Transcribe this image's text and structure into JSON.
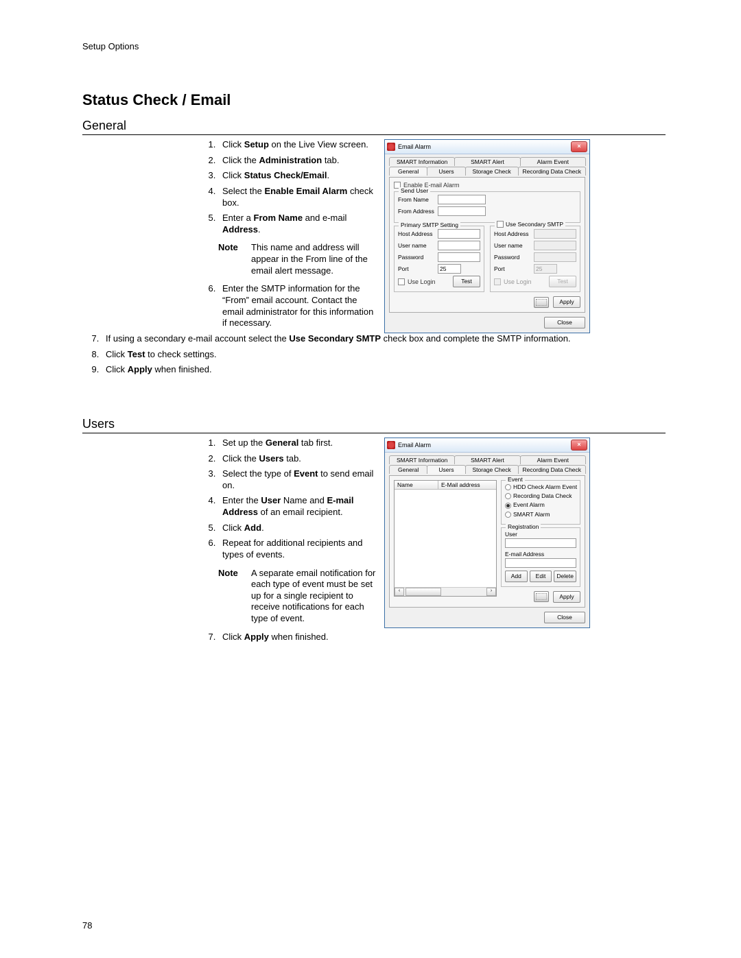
{
  "page": {
    "header": "Setup Options",
    "title": "Status Check / Email",
    "pageNumber": "78"
  },
  "general": {
    "heading": "General",
    "steps": {
      "s1a": "Click ",
      "s1b": "Setup",
      "s1c": " on the Live View screen.",
      "s2a": "Click the ",
      "s2b": "Administration",
      "s2c": " tab.",
      "s3a": "Click ",
      "s3b": "Status Check/Email",
      "s3c": ".",
      "s4a": "Select the ",
      "s4b": "Enable Email Alarm",
      "s4c": " check box.",
      "s5a": "Enter a ",
      "s5b": "From Name",
      "s5c": " and e-mail ",
      "s5d": "Address",
      "s5e": ".",
      "s6": "Enter the SMTP information for the “From” email account. Contact the email administrator for this information if necessary.",
      "s7a": "If using a secondary e-mail account select the ",
      "s7b": "Use Secondary SMTP",
      "s7c": " check box and complete the SMTP information.",
      "s8a": "Click ",
      "s8b": "Test",
      "s8c": " to check settings.",
      "s9a": "Click ",
      "s9b": "Apply",
      "s9c": " when finished."
    },
    "noteLabel": "Note",
    "noteText": "This name and address will appear in the From line of the email alert message."
  },
  "users": {
    "heading": "Users",
    "steps": {
      "s1a": "Set up the ",
      "s1b": "General",
      "s1c": " tab first.",
      "s2a": "Click the ",
      "s2b": "Users",
      "s2c": " tab.",
      "s3a": "Select the type of ",
      "s3b": "Event",
      "s3c": " to send email on.",
      "s4a": "Enter the ",
      "s4b": "User",
      "s4c": " Name and ",
      "s4d": "E-mail Address",
      "s4e": " of an email recipient.",
      "s5a": "Click ",
      "s5b": "Add",
      "s5c": ".",
      "s6": "Repeat for additional recipients and types of events.",
      "s7a": "Click ",
      "s7b": "Apply",
      "s7c": " when finished."
    },
    "noteLabel": "Note",
    "noteText": "A separate email notification for each type of event must be set up for a single recipient to receive notifications for each type of event."
  },
  "dlg1": {
    "title": "Email Alarm",
    "tabs": {
      "smartInfo": "SMART Information",
      "smartAlert": "SMART Alert",
      "alarmEvent": "Alarm Event",
      "general": "General",
      "users": "Users",
      "storageCheck": "Storage Check",
      "recordingDataCheck": "Recording Data Check"
    },
    "enableEmail": "Enable E-mail Alarm",
    "sendUser": "Send User",
    "fromName": "From Name",
    "fromAddress": "From Address",
    "primary": "Primary SMTP Setting",
    "secondary": "Use Secondary SMTP",
    "hostAddress": "Host Address",
    "userName": "User name",
    "password": "Password",
    "port": "Port",
    "portValue": "25",
    "useLogin": "Use Login",
    "test": "Test",
    "apply": "Apply",
    "close": "Close"
  },
  "dlg2": {
    "title": "Email Alarm",
    "colName": "Name",
    "colEmail": "E-Mail address",
    "event": "Event",
    "optHdd": "HDD Check Alarm Event",
    "optRec": "Recording Data Check",
    "optAlarm": "Event Alarm",
    "optSmart": "SMART Alarm",
    "registration": "Registration",
    "user": "User",
    "emailAddress": "E-mail Address",
    "add": "Add",
    "edit": "Edit",
    "delete": "Delete",
    "apply": "Apply",
    "close": "Close"
  }
}
